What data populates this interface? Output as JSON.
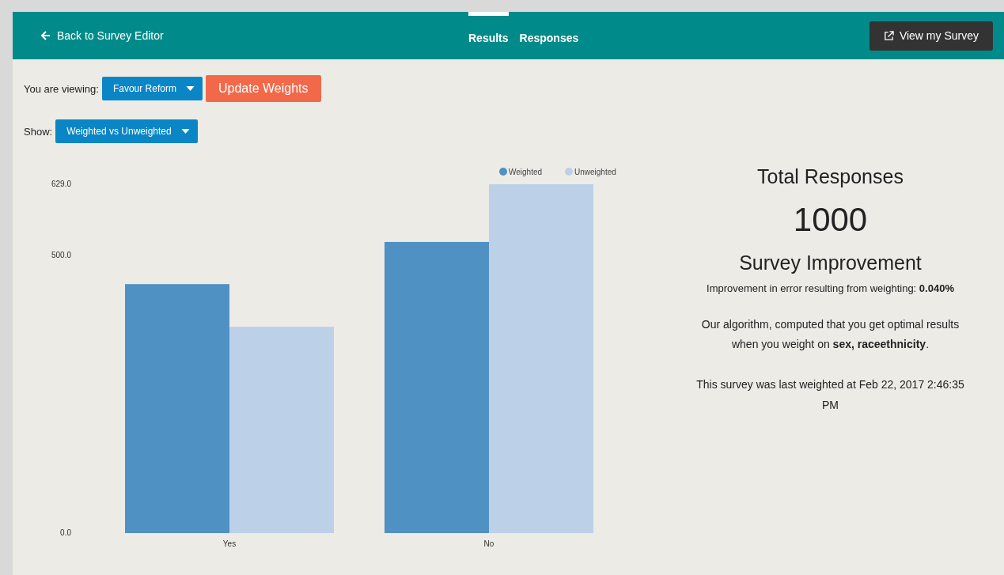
{
  "header": {
    "back_link": "Back to Survey Editor",
    "tabs": [
      {
        "label": "Results",
        "selected": true
      },
      {
        "label": "Responses",
        "selected": false
      }
    ],
    "view_button": "View my Survey"
  },
  "controls": {
    "viewing_label": "You are viewing:",
    "viewing_value": "Favour Reform",
    "update_button": "Update Weights",
    "show_label": "Show:",
    "show_value": "Weighted vs Unweighted"
  },
  "chart_data": {
    "type": "bar",
    "categories": [
      "Yes",
      "No"
    ],
    "series": [
      {
        "name": "Weighted",
        "color": "#4f91c3",
        "values": [
          449,
          525
        ]
      },
      {
        "name": "Unweighted",
        "color": "#bcd0e8",
        "values": [
          372,
          629
        ]
      }
    ],
    "legend": "top-right",
    "ylim": [
      0,
      629
    ],
    "yticks": [
      {
        "value": 0,
        "label": "0.0"
      },
      {
        "value": 500,
        "label": "500.0"
      },
      {
        "value": 629,
        "label": "629.0"
      }
    ]
  },
  "summary": {
    "total_title": "Total Responses",
    "total_value": "1000",
    "improvement_title": "Survey Improvement",
    "improvement_text": "Improvement in error resulting from weighting: **0.040%**",
    "algorithm_text": "Our algorithm, computed that you get optimal results when you weight on **sex, raceethnicity**.",
    "last_weighted_text": "This survey was last weighted at Feb 22, 2017 2:46:35 PM"
  }
}
